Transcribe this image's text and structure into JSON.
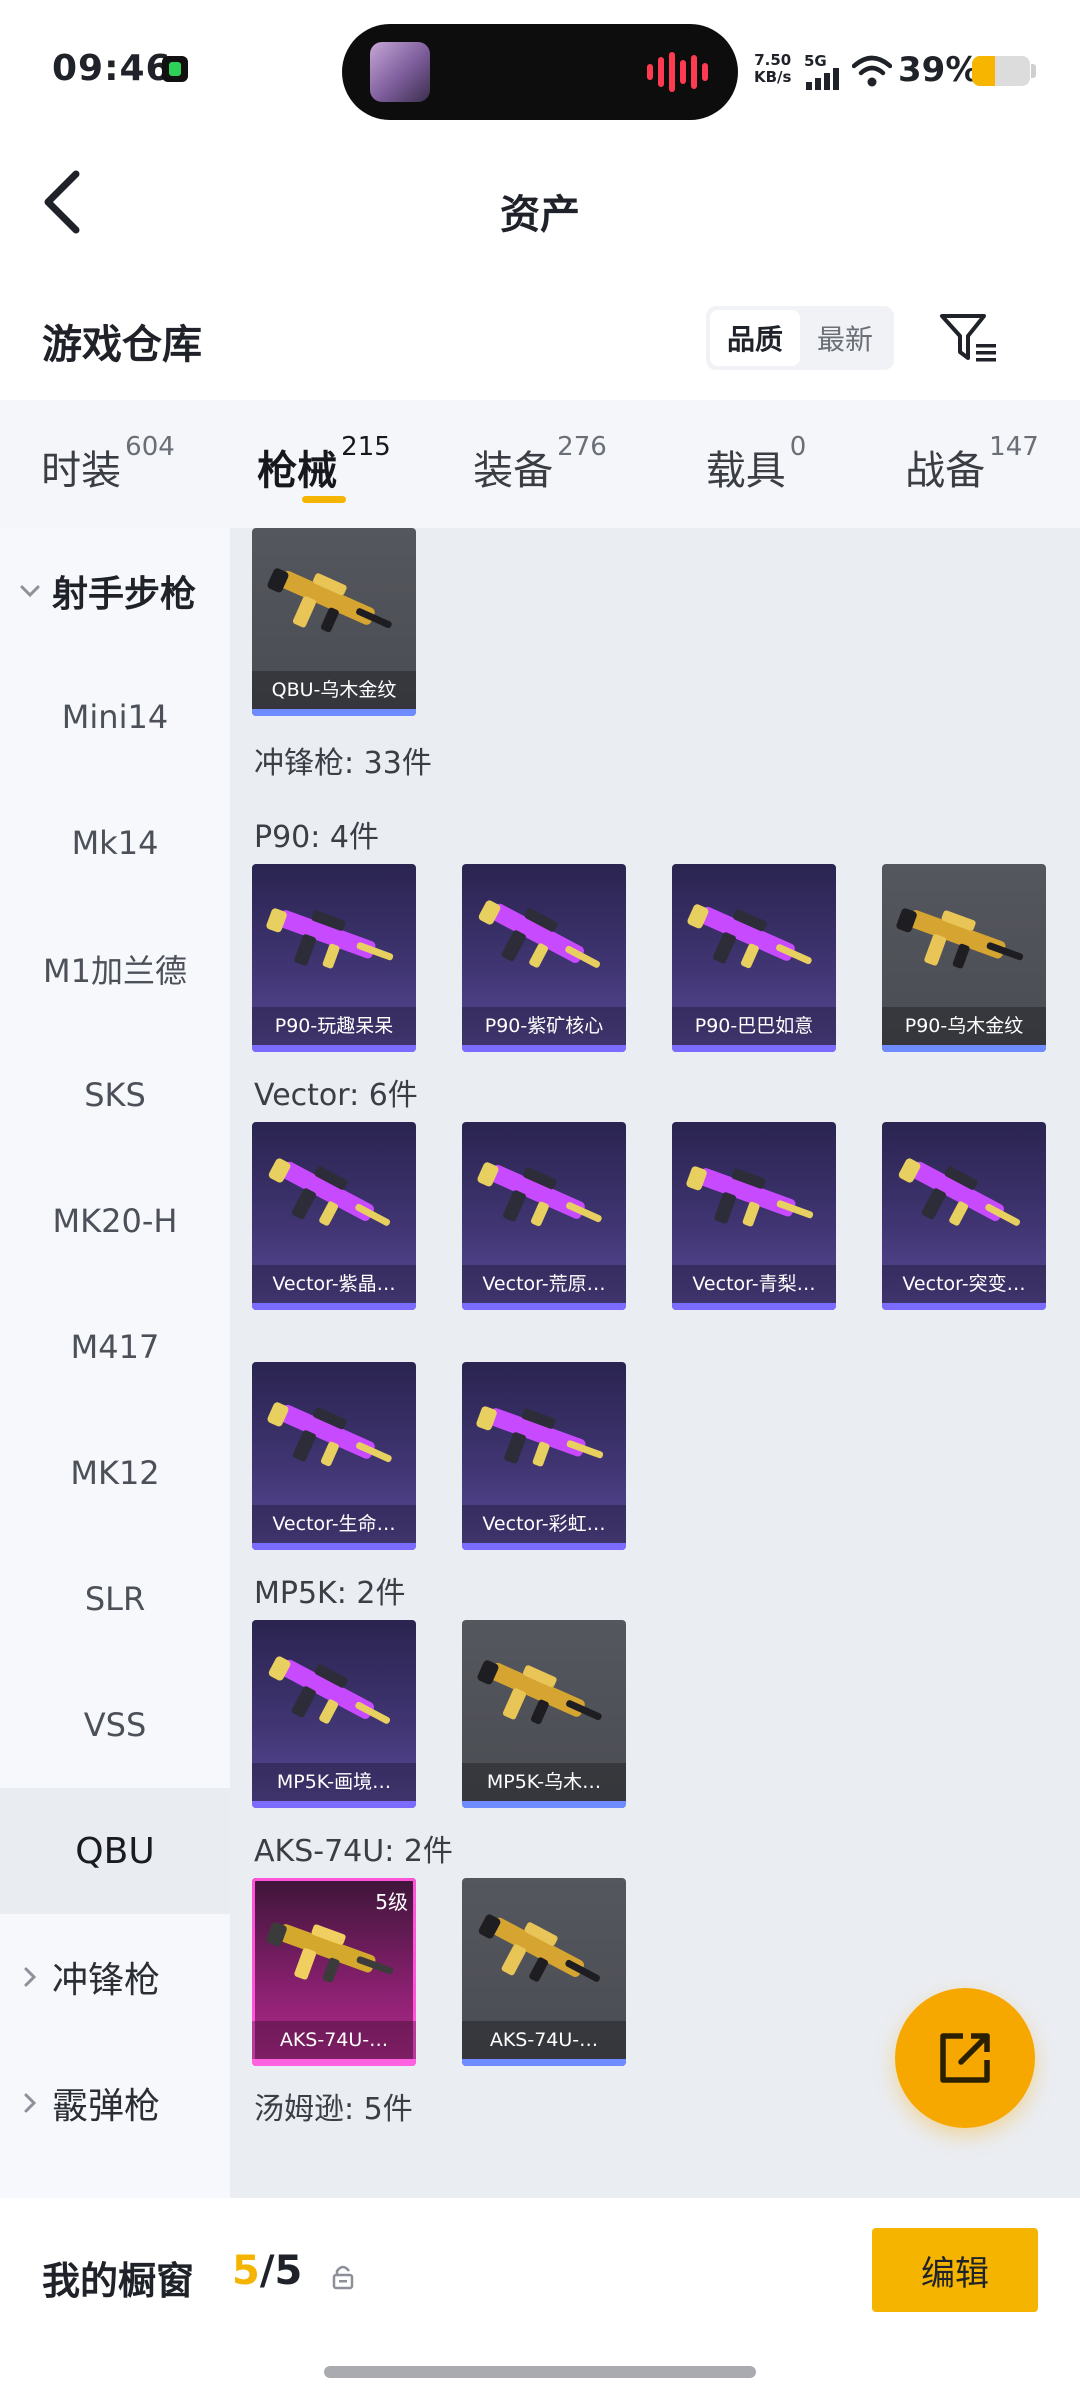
{
  "status_bar": {
    "time": "09:46",
    "network_speed": "7.50\nKB/s",
    "network_speed_value": "7.50",
    "network_speed_unit": "KB/s",
    "cellular": "5G",
    "battery_percent": "39%",
    "battery_level": 0.39,
    "battery_color": "#f7b500"
  },
  "nav": {
    "title": "资产",
    "back_icon": "back-chevron-icon"
  },
  "section": {
    "title": "游戏仓库",
    "sort_options": [
      "品质",
      "最新"
    ],
    "sort_selected": "品质",
    "filter_icon": "filter-icon"
  },
  "tabs": [
    {
      "label": "时装",
      "count": "604",
      "active": false
    },
    {
      "label": "枪械",
      "count": "215",
      "active": true
    },
    {
      "label": "装备",
      "count": "276",
      "active": false
    },
    {
      "label": "载具",
      "count": "0",
      "active": false
    },
    {
      "label": "战备",
      "count": "147",
      "active": false
    }
  ],
  "sidebar": {
    "group_open": "射手步枪",
    "items": [
      "Mini14",
      "Mk14",
      "M1加兰德",
      "SKS",
      "MK20-H",
      "M417",
      "MK12",
      "SLR",
      "VSS",
      "QBU"
    ],
    "selected": "QBU",
    "collapsed_groups": [
      "冲锋枪",
      "霰弹枪"
    ]
  },
  "content": {
    "top_card": {
      "caption": "QBU-乌木金纹",
      "style": "gold"
    },
    "category_summary": "冲锋枪: 33件",
    "groups": [
      {
        "label": "P90: 4件",
        "cards": [
          {
            "caption": "P90-玩趣呆呆",
            "style": "purple"
          },
          {
            "caption": "P90-紫矿核心",
            "style": "purple"
          },
          {
            "caption": "P90-巴巴如意",
            "style": "purple"
          },
          {
            "caption": "P90-乌木金纹",
            "style": "gold"
          }
        ]
      },
      {
        "label": "Vector: 6件",
        "cards": [
          {
            "caption": "Vector-紫晶…",
            "style": "purple"
          },
          {
            "caption": "Vector-荒原…",
            "style": "purple"
          },
          {
            "caption": "Vector-青梨…",
            "style": "purple"
          },
          {
            "caption": "Vector-突变…",
            "style": "purple"
          },
          {
            "caption": "Vector-生命…",
            "style": "purple"
          },
          {
            "caption": "Vector-彩虹…",
            "style": "purple"
          }
        ]
      },
      {
        "label": "MP5K: 2件",
        "cards": [
          {
            "caption": "MP5K-画境…",
            "style": "purple"
          },
          {
            "caption": "MP5K-乌木…",
            "style": "gold"
          }
        ]
      },
      {
        "label": "AKS-74U: 2件",
        "cards": [
          {
            "caption": "AKS-74U-…",
            "style": "pink",
            "level": "5级"
          },
          {
            "caption": "AKS-74U-…",
            "style": "gold"
          }
        ]
      },
      {
        "label": "汤姆逊: 5件",
        "cards": []
      }
    ],
    "fab_icon": "share-external-icon"
  },
  "bottom_bar": {
    "title": "我的橱窗",
    "count_current": "5",
    "count_total": "/5",
    "lock_icon": "lock-icon",
    "edit_label": "编辑"
  },
  "colors": {
    "accent": "#f5b400",
    "purple_tier": "#7b6bff",
    "gold_tier": "#6e8cff",
    "pink_tier": "#ff62e0"
  }
}
